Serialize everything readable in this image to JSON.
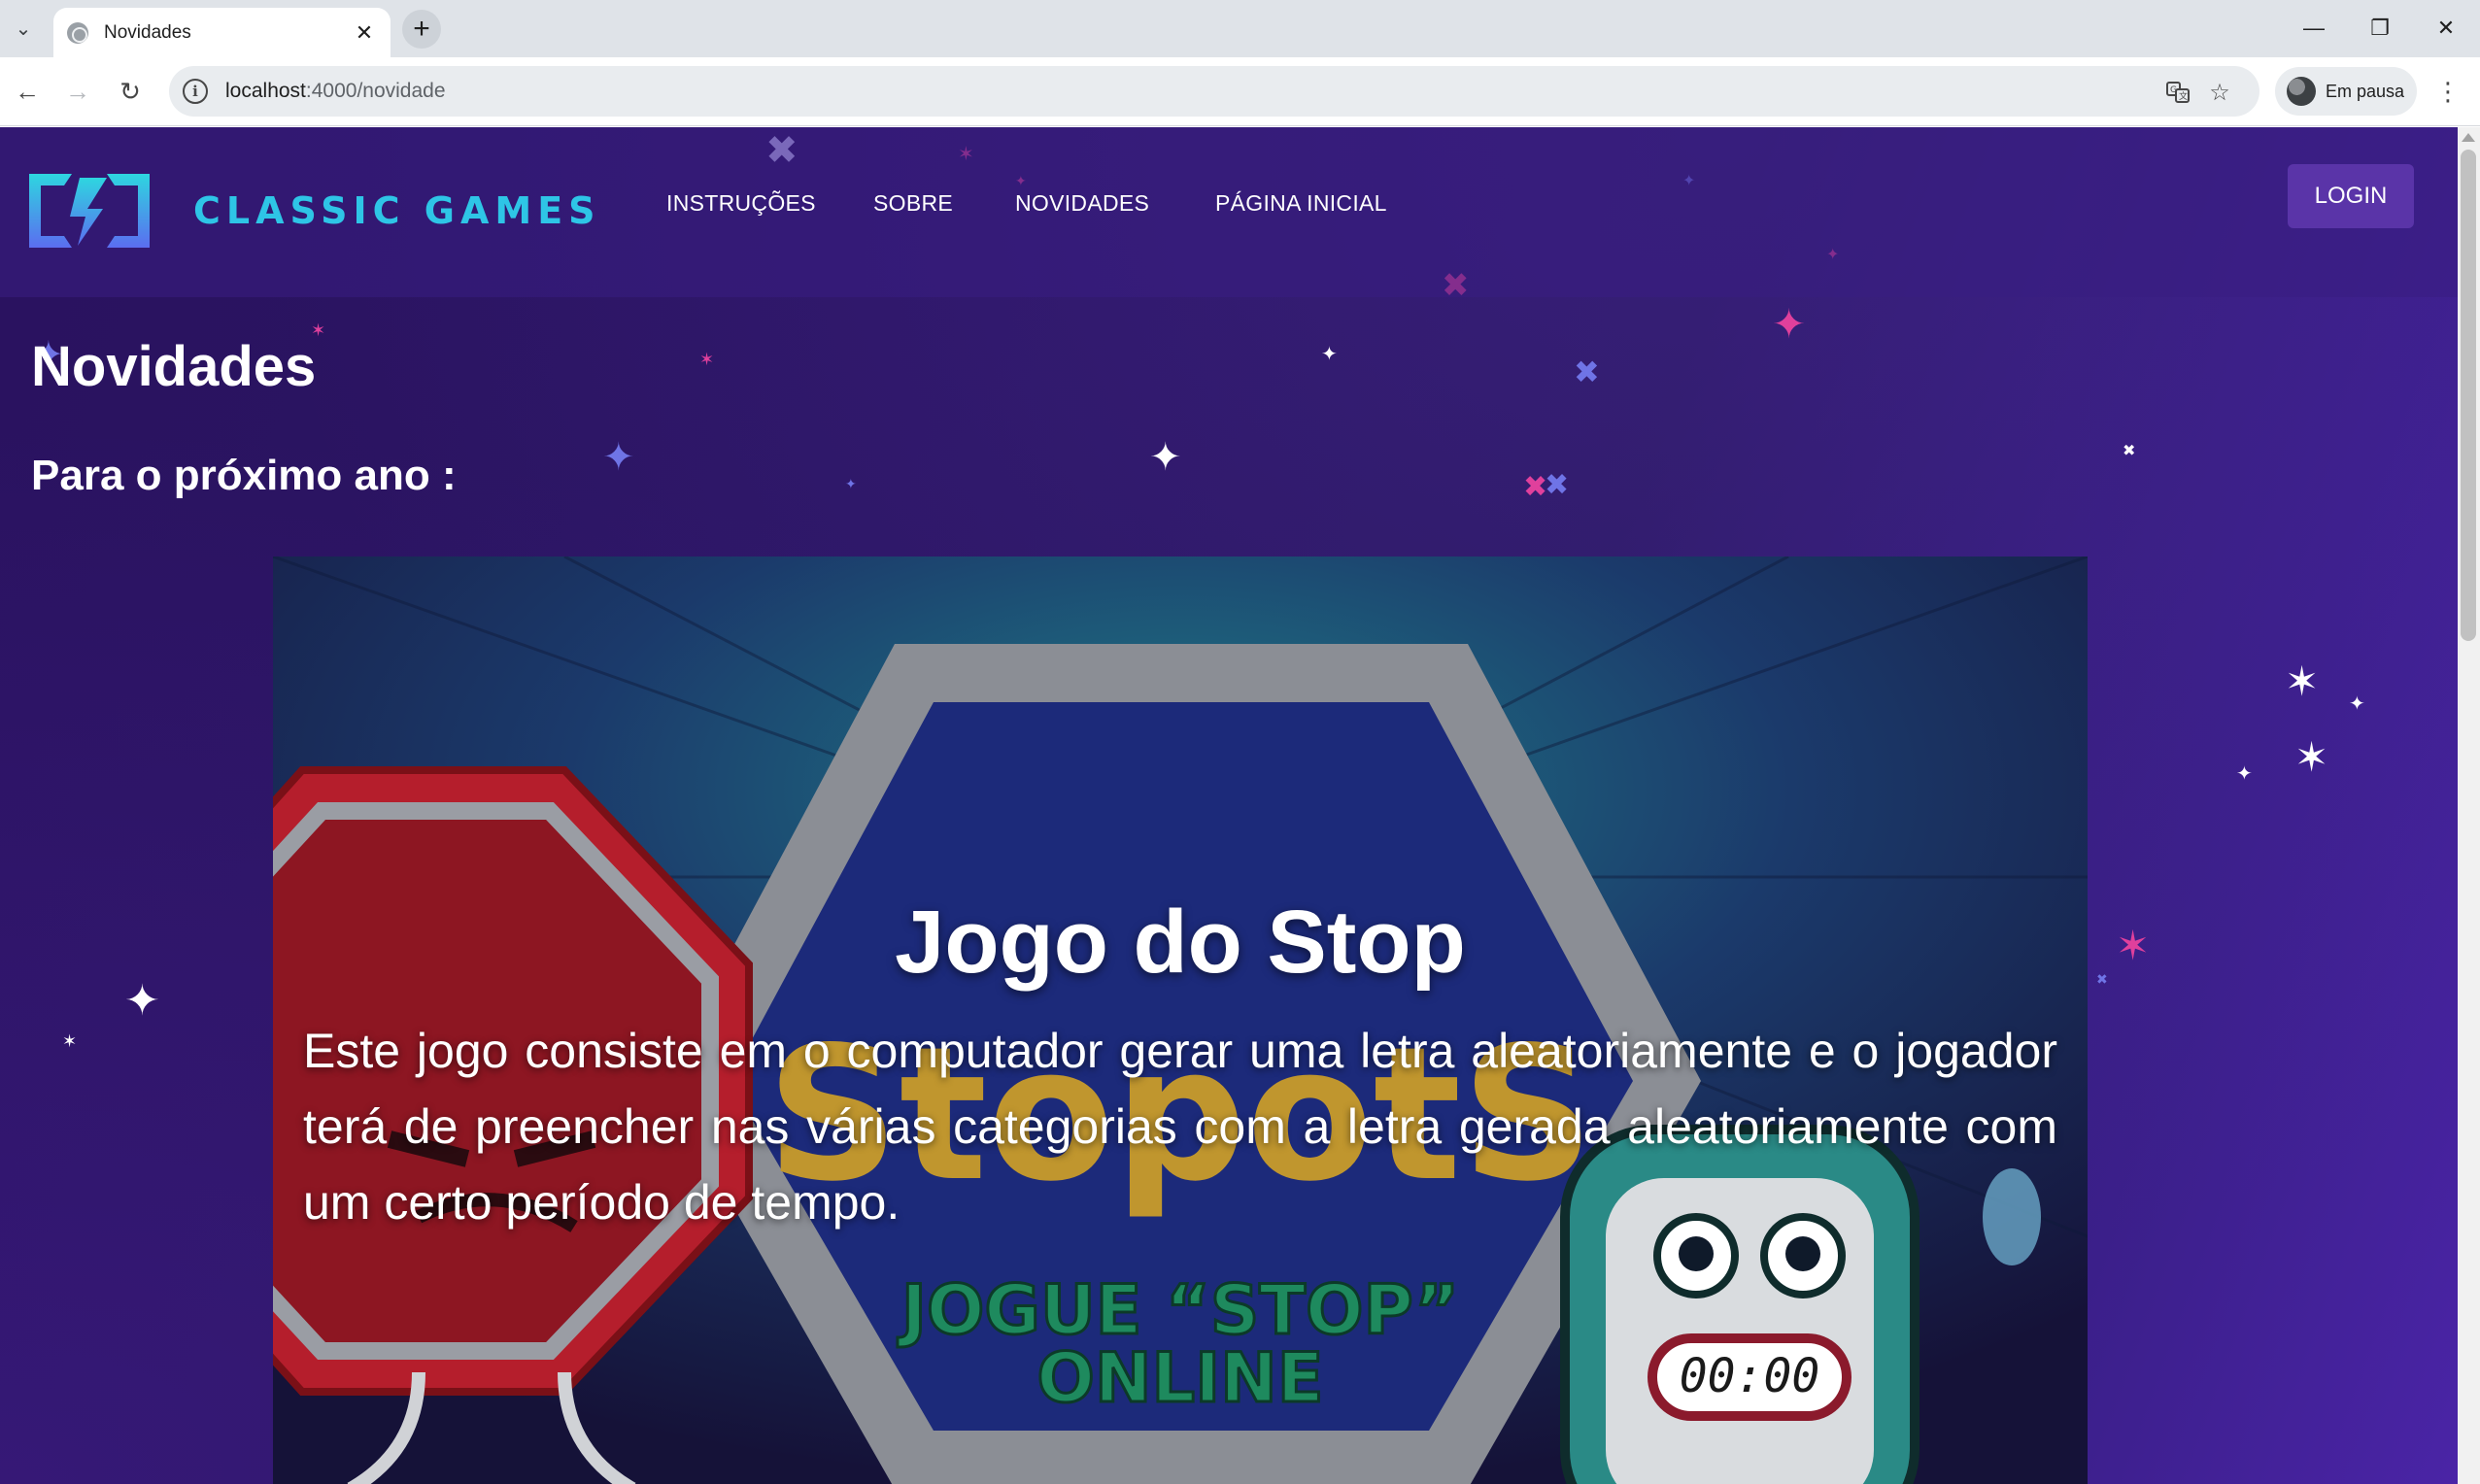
{
  "browser": {
    "tab_title": "Novidades",
    "url_host": "localhost",
    "url_path": ":4000/novidade",
    "profile_label": "Em pausa"
  },
  "site": {
    "brand": "CLASSIC GAMES",
    "nav": [
      "INSTRUÇÕES",
      "SOBRE",
      "NOVIDADES",
      "PÁGINA INICIAL"
    ],
    "login_label": "LOGIN"
  },
  "page": {
    "title": "Novidades",
    "subtitle": "Para o próximo ano :"
  },
  "card": {
    "title": "Jogo do Stop",
    "description": "Este jogo consiste em o computador gerar uma letra aleatoriamente e o jogador terá de preencher nas várias categorias com a letra gerada aleatoriamente com um certo período de tempo.",
    "art_logo": "StopotS",
    "art_banner_line1": "JOGUE “STOP”",
    "art_banner_line2": "ONLINE",
    "art_timer": "00:00"
  },
  "colors": {
    "brand_cyan": "#2ec5e6",
    "page_purple": "#2b1662",
    "login_purple": "#5a34a8"
  }
}
